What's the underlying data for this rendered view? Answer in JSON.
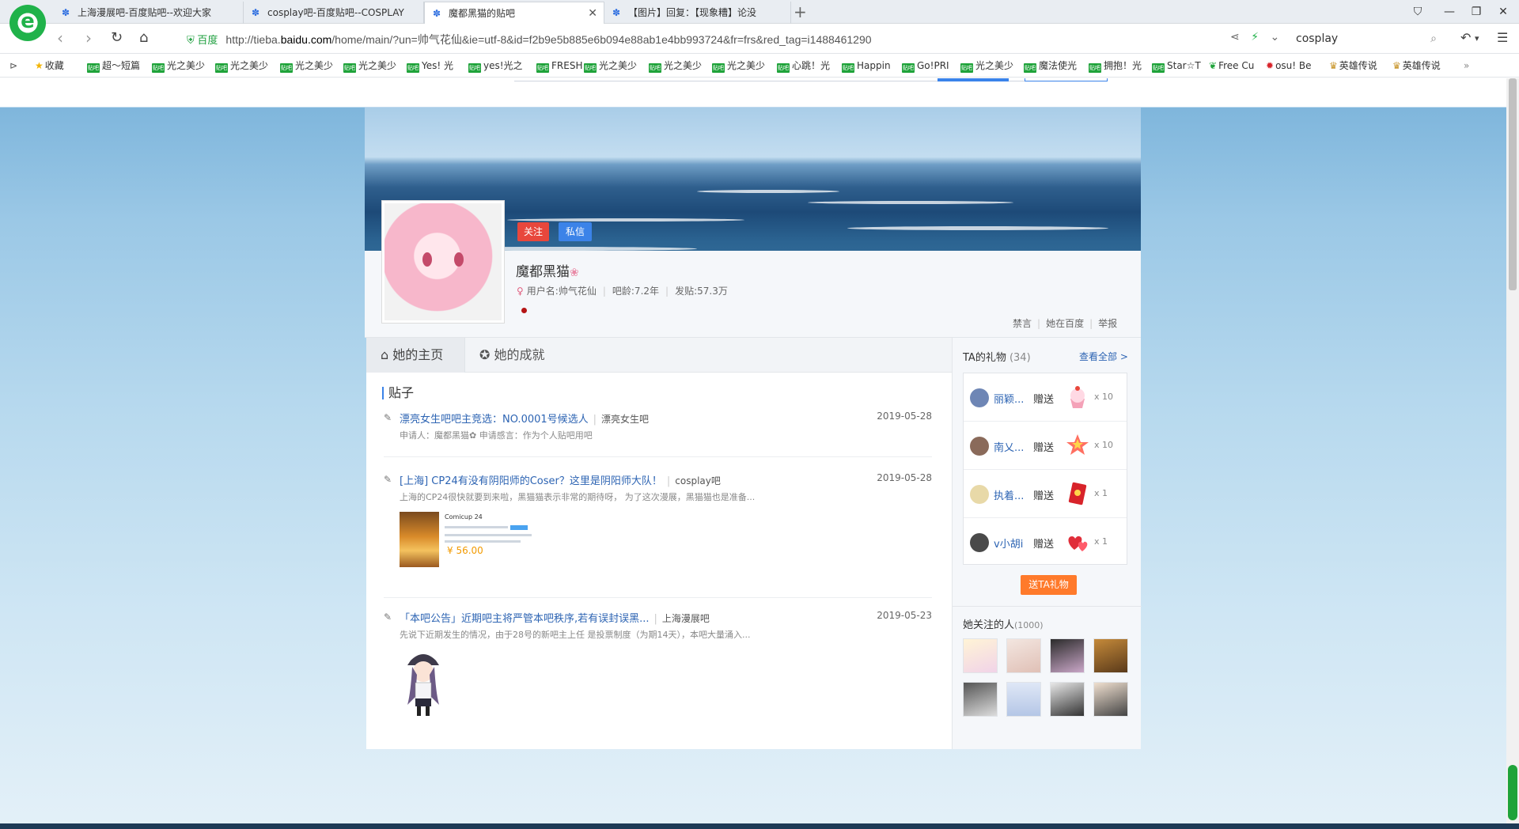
{
  "tabs": [
    {
      "title": "上海漫展吧-百度贴吧--欢迎大家",
      "active": false
    },
    {
      "title": "cosplay吧-百度贴吧--COSPLAY",
      "active": false
    },
    {
      "title": "魔都黑猫的贴吧",
      "active": true
    },
    {
      "title": "【图片】回复：【现象糟】论没",
      "active": false
    }
  ],
  "address": {
    "cert_label": "百度",
    "url_prefix": "http://tieba.",
    "url_host": "baidu.com",
    "url_rest": "/home/main/?un=帅气花仙&ie=utf-8&id=f2b9e5b885e6b094e88ab1e4bb993724&fr=frs&red_tag=i1488461290",
    "search_value": "cosplay"
  },
  "bookmarks": [
    {
      "label": "收藏",
      "type": "star"
    },
    {
      "label": "超～短篇",
      "type": "tieba"
    },
    {
      "label": "光之美少",
      "type": "tieba"
    },
    {
      "label": "光之美少",
      "type": "tieba"
    },
    {
      "label": "光之美少",
      "type": "tieba"
    },
    {
      "label": "光之美少",
      "type": "tieba"
    },
    {
      "label": "Yes! 光",
      "type": "tieba"
    },
    {
      "label": "yes!光之",
      "type": "tieba"
    },
    {
      "label": "FRESH",
      "type": "tieba"
    },
    {
      "label": "光之美少",
      "type": "tieba"
    },
    {
      "label": "光之美少",
      "type": "tieba"
    },
    {
      "label": "光之美少",
      "type": "tieba"
    },
    {
      "label": "心跳！光",
      "type": "tieba"
    },
    {
      "label": "Happin",
      "type": "tieba"
    },
    {
      "label": "Go!PRI",
      "type": "tieba"
    },
    {
      "label": "光之美少",
      "type": "tieba"
    },
    {
      "label": "魔法使光",
      "type": "tieba"
    },
    {
      "label": "拥抱！光",
      "type": "tieba"
    },
    {
      "label": "Star☆T",
      "type": "tieba"
    },
    {
      "label": "Free Cu",
      "type": "leaf"
    },
    {
      "label": "osu! Be",
      "type": "osu"
    },
    {
      "label": "英雄传说",
      "type": "hero"
    },
    {
      "label": "英雄传说",
      "type": "hero"
    }
  ],
  "profile": {
    "follow_label": "关注",
    "message_label": "私信",
    "display_name": "魔都黑猫",
    "username": "用户名:帅气花仙",
    "age": "吧龄:7.2年",
    "posts": "发贴:57.3万",
    "links": [
      "禁言",
      "她在百度",
      "举报"
    ]
  },
  "page_tabs": [
    "她的主页",
    "她的成就"
  ],
  "section_title": "贴子",
  "posts": [
    {
      "title": "漂亮女生吧吧主竞选：NO.0001号候选人",
      "forum": "漂亮女生吧",
      "date": "2019-05-28",
      "desc": "申请人：魔都黑猫✿ 申请感言：作为个人贴吧用吧"
    },
    {
      "title": "[上海] CP24有没有阴阳师的Coser？这里是阴阳师大队！",
      "forum": "cosplay吧",
      "date": "2019-05-28",
      "desc": "上海的CP24很快就要到来啦，黑猫猫表示非常的期待呀， 为了这次漫展，黑猫猫也是准备...",
      "ticket": {
        "name": "Comicup 24",
        "price": "¥ 56.00"
      }
    },
    {
      "title": "「本吧公告」近期吧主将严管本吧秩序,若有误封误黑...",
      "forum": "上海漫展吧",
      "date": "2019-05-23",
      "desc": "先说下近期发生的情况，由于28号的新吧主上任 是投票制度（为期14天），本吧大量涌入..."
    }
  ],
  "gifts": {
    "title": "TA的礼物",
    "count": "(34)",
    "view_all": "查看全部 >",
    "send_label": "送TA礼物",
    "items": [
      {
        "name": "丽颖...",
        "verb": "赠送",
        "qty": "x 10",
        "gift": "cupcake"
      },
      {
        "name": "南乂...",
        "verb": "赠送",
        "qty": "x 10",
        "gift": "star-wand"
      },
      {
        "name": "执着...",
        "verb": "赠送",
        "qty": "x 1",
        "gift": "red-envelope"
      },
      {
        "name": "v小胡i",
        "verb": "赠送",
        "qty": "x 1",
        "gift": "hearts"
      }
    ]
  },
  "following": {
    "title": "她关注的人",
    "count": "(1000)"
  },
  "colors": {
    "link_blue": "#2d64b3",
    "follow_red": "#e8473c",
    "message_blue": "#3b83e8",
    "gift_orange": "#ff7a2b",
    "brand_green": "#20b24a"
  }
}
